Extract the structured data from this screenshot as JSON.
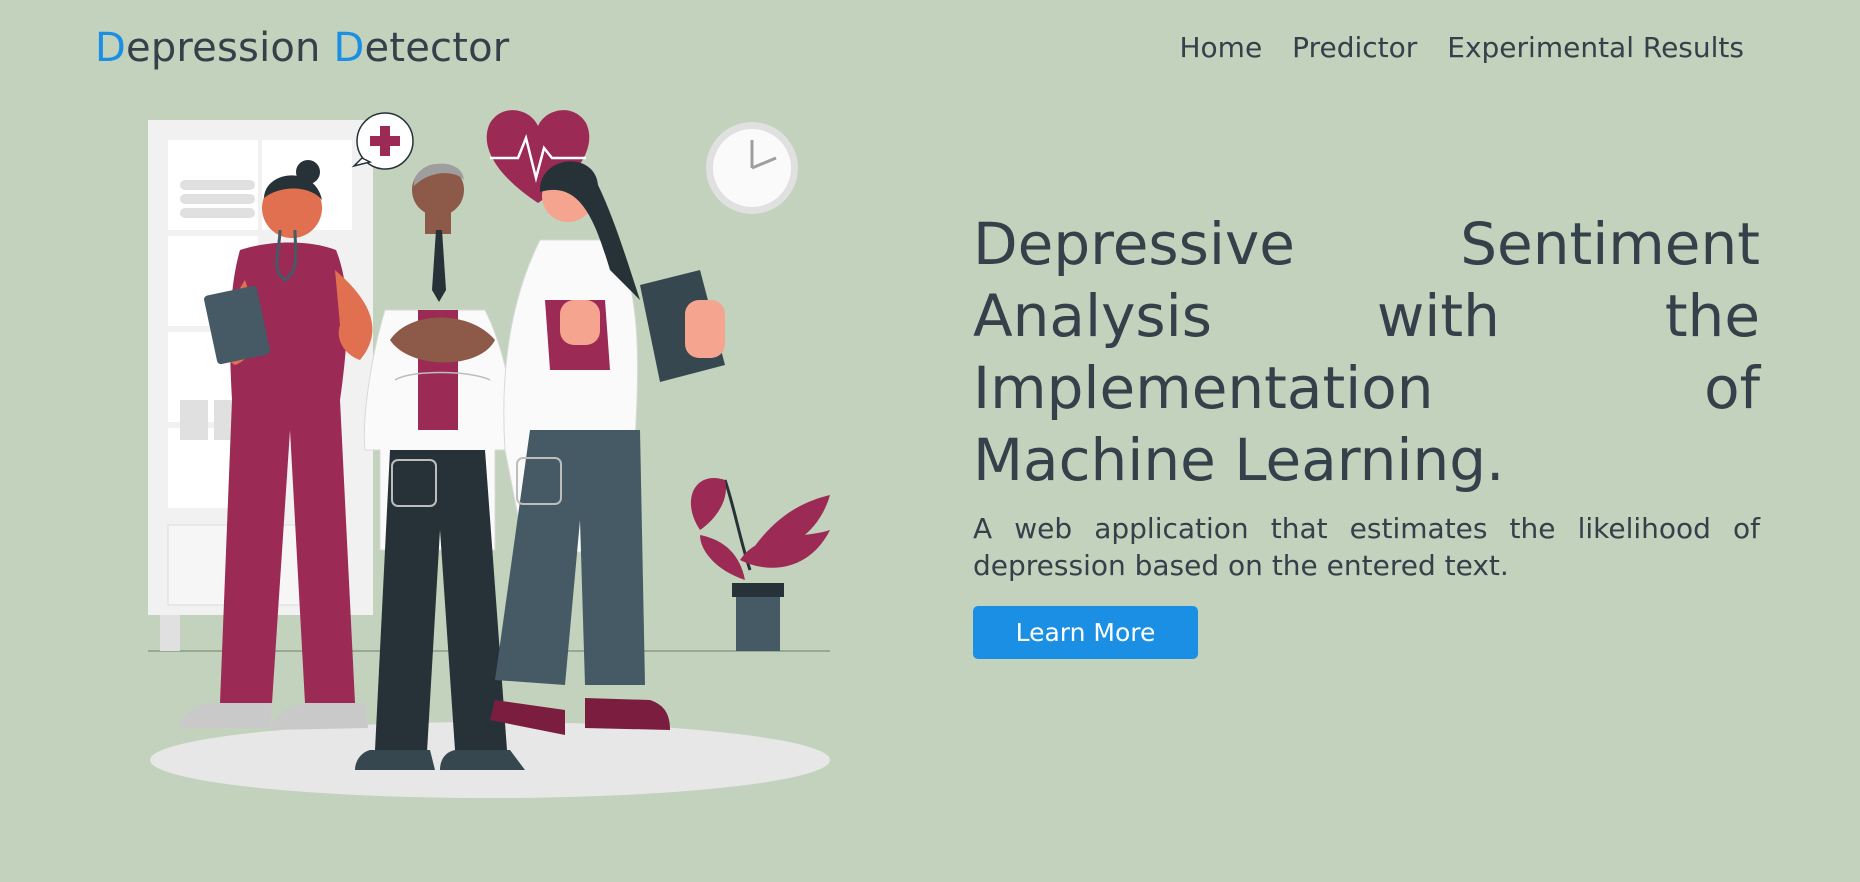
{
  "navbar": {
    "brand_word1_initial": "D",
    "brand_word1_rest": "epression",
    "brand_word2_initial": "D",
    "brand_word2_rest": "etector",
    "links": [
      "Home",
      "Predictor",
      "Experimental Results"
    ]
  },
  "hero": {
    "title": "Depressive Sentiment Analysis with the Implementation of Machine Learning.",
    "subtitle": "A web application that estimates the likelihood of depression based on the entered text.",
    "cta_label": "Learn More"
  },
  "colors": {
    "background": "#c2d2bc",
    "accent": "#1a8fe3",
    "text": "#34404a",
    "illustration_maroon": "#9b2a55",
    "illustration_dark": "#263238"
  },
  "illustration": {
    "icons": [
      "medical-cross-icon",
      "heartbeat-icon",
      "clock-icon"
    ]
  }
}
